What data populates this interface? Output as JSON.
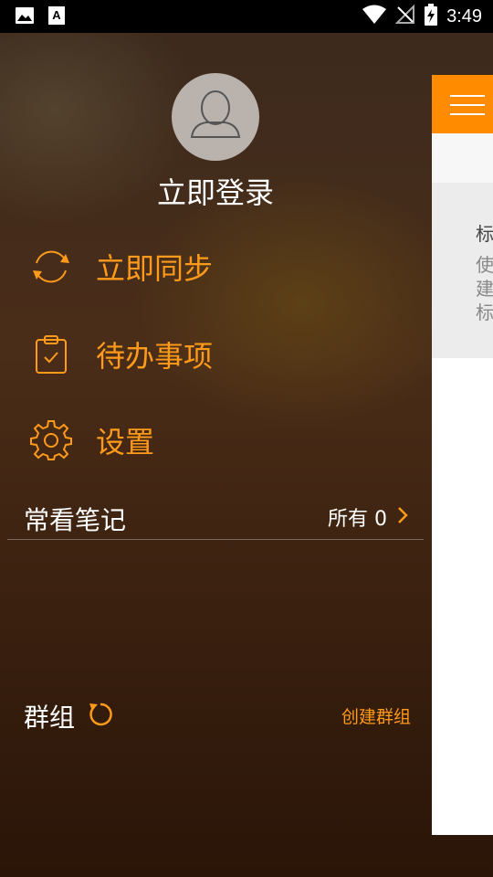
{
  "status_bar": {
    "time": "3:49",
    "icons": [
      "image-notification-icon",
      "font-notification-icon",
      "wifi-icon",
      "no-signal-icon",
      "battery-charging-icon"
    ]
  },
  "drawer": {
    "login_label": "立即登录",
    "menu": [
      {
        "label": "立即同步",
        "icon": "sync-icon"
      },
      {
        "label": "待办事项",
        "icon": "clipboard-check-icon"
      },
      {
        "label": "设置",
        "icon": "gear-icon"
      }
    ],
    "notes_section": {
      "title": "常看笔记",
      "all_label": "所有 0"
    },
    "groups": {
      "title": "群组",
      "create_label": "创建群组"
    }
  },
  "content_panel": {
    "card_title": "标",
    "card_lines": [
      "使",
      "建",
      "标"
    ]
  },
  "colors": {
    "accent": "#ff9a1a",
    "toolbar": "#ff8c00"
  }
}
